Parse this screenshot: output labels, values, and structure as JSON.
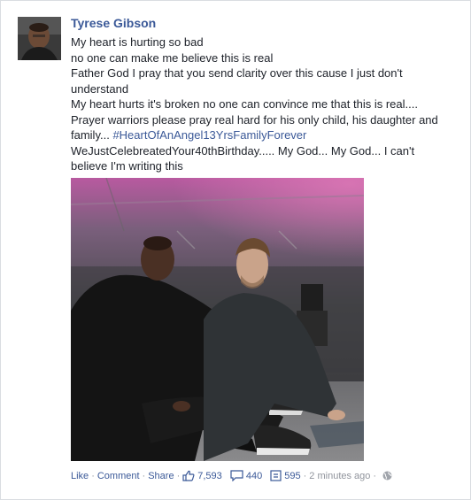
{
  "post": {
    "author": "Tyrese Gibson",
    "message_lines": [
      "My heart is hurting so bad",
      "no one can make me believe this is real",
      "Father God I pray that you send clarity over this cause I just don't",
      "understand",
      "My heart hurts it's broken no one can convince me that this is real....",
      "Prayer warriors please pray real hard for his only child, his daughter and"
    ],
    "family_text": "family... ",
    "hashtag": "#HeartOfAnAngel13YrsFamilyForever",
    "closing_lines": [
      "WeJustCelebreatedYour40thBirthday..... My God... My God... I can't",
      "believe I'm writing this"
    ]
  },
  "actions": {
    "like_label": "Like",
    "comment_label": "Comment",
    "share_label": "Share",
    "separator": "·",
    "likes_count": "7,593",
    "comments_count": "440",
    "shares_count": "595",
    "timestamp": "2 minutes ago",
    "privacy_icon": "globe-icon"
  },
  "colors": {
    "link_blue": "#3b5998",
    "text": "#1d2129",
    "meta_gray": "#90949c"
  }
}
